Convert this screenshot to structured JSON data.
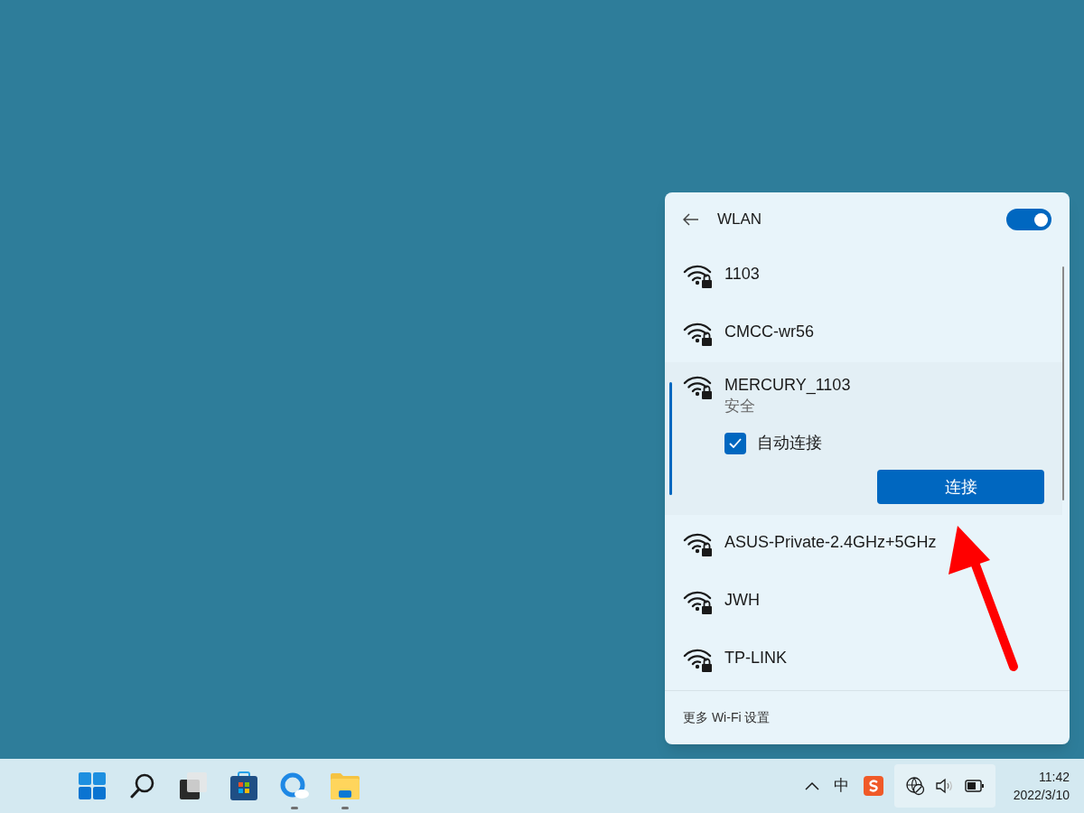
{
  "wlan_panel": {
    "title": "WLAN",
    "wifi_on": true,
    "networks": [
      {
        "name": "1103",
        "selected": false
      },
      {
        "name": "CMCC-wr56",
        "selected": false
      },
      {
        "name": "MERCURY_1103",
        "selected": true,
        "status": "安全",
        "auto_connect": {
          "label": "自动连接",
          "checked": true
        },
        "connect_button": "连接"
      },
      {
        "name": "ASUS-Private-2.4GHz+5GHz",
        "selected": false
      },
      {
        "name": "JWH",
        "selected": false
      },
      {
        "name": "TP-LINK",
        "selected": false
      }
    ],
    "footer_link": "更多 Wi-Fi 设置"
  },
  "taskbar": {
    "apps": [
      {
        "kind": "start",
        "running": false
      },
      {
        "kind": "search",
        "running": false
      },
      {
        "kind": "taskview",
        "running": false
      },
      {
        "kind": "store",
        "running": false
      },
      {
        "kind": "browser",
        "running": true
      },
      {
        "kind": "folder",
        "running": true
      }
    ],
    "input_method": "中",
    "time": "11:42",
    "date": "2022/3/10"
  }
}
